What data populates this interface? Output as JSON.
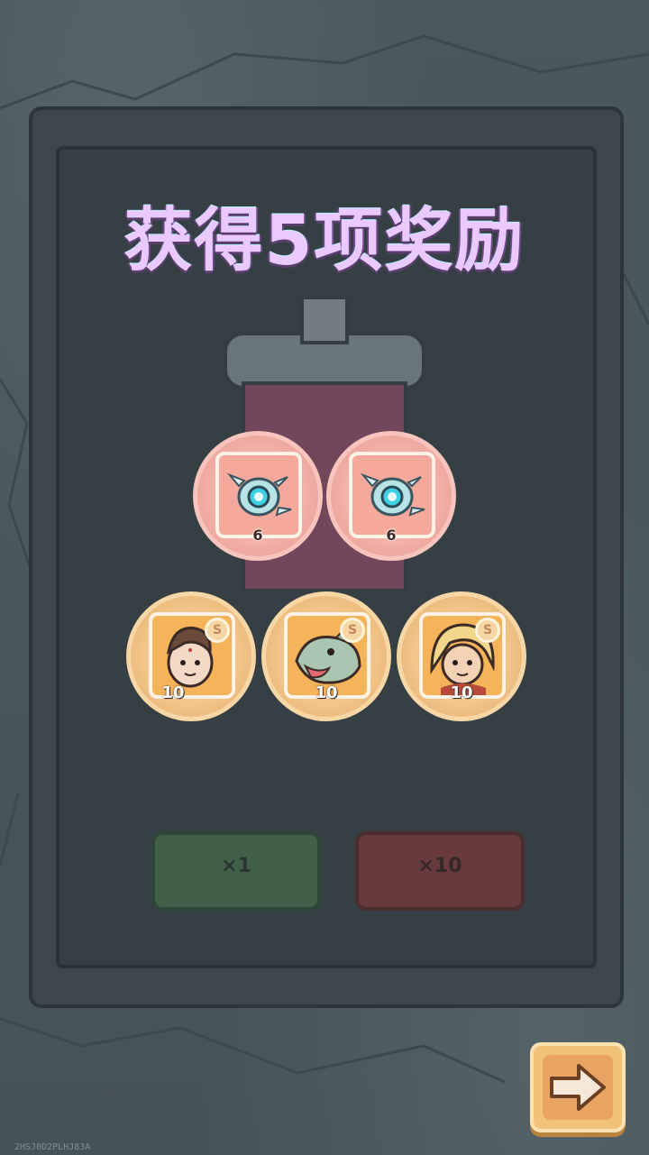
{
  "title": "获得5项奖励",
  "rewards": [
    {
      "type": "item",
      "icon": "orb-drone-icon",
      "count": "6"
    },
    {
      "type": "item",
      "icon": "orb-drone-icon",
      "count": "6"
    },
    {
      "type": "hero",
      "icon": "warrior-portrait-icon",
      "count": "10",
      "badge": "S"
    },
    {
      "type": "hero",
      "icon": "dragon-portrait-icon",
      "count": "10",
      "badge": "S"
    },
    {
      "type": "hero",
      "icon": "blonde-hero-portrait-icon",
      "count": "10",
      "badge": "S"
    }
  ],
  "next_button": {
    "icon": "arrow-right-icon"
  },
  "machine_buttons": {
    "single": "×1",
    "ten": "×10"
  },
  "serial": "2HSJ0D2PLHJ83A",
  "colors": {
    "pink_reward": "#f2b0a8",
    "gold_reward": "#f2c58a",
    "title": "#e9c9ff"
  }
}
